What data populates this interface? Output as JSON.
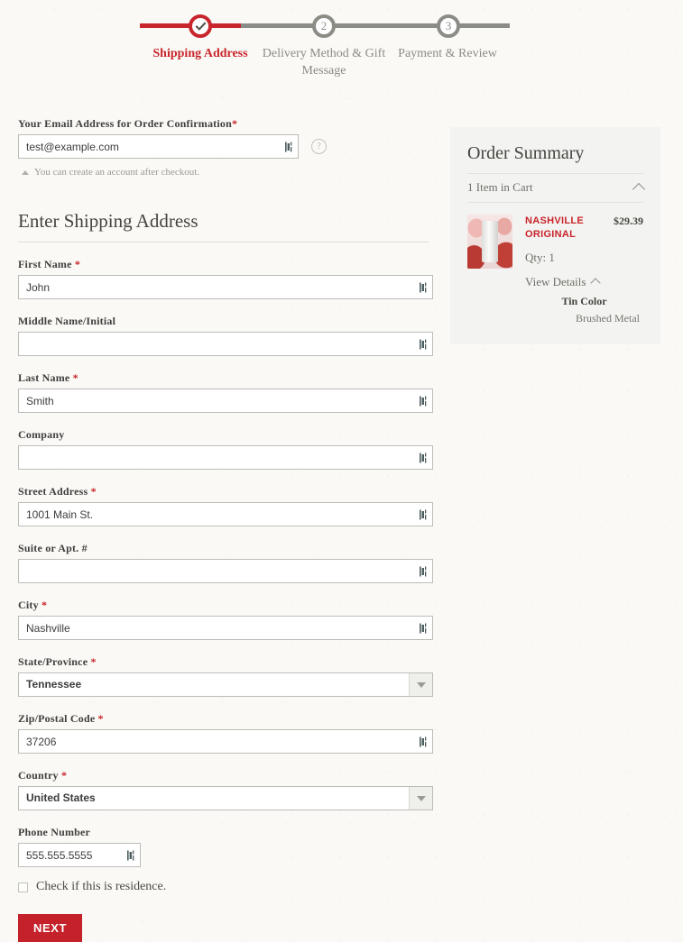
{
  "progress": {
    "steps": [
      {
        "number": "1",
        "label": "Shipping Address",
        "state": "complete",
        "icon": "check-icon"
      },
      {
        "number": "2",
        "label": "Delivery Method & Gift Message",
        "state": "upcoming"
      },
      {
        "number": "3",
        "label": "Payment & Review",
        "state": "upcoming"
      }
    ],
    "accent_color": "#c8252c",
    "inactive_color": "#8c8c86"
  },
  "email_section": {
    "label": "Your Email Address for Order Confirmation",
    "required_marker": "*",
    "value": "test@example.com",
    "placeholder": "",
    "help_icon": "?",
    "note": "You can create an account after checkout."
  },
  "shipping": {
    "heading": "Enter Shipping Address",
    "fields": [
      {
        "label": "First Name",
        "required": true,
        "value": "John",
        "type": "text"
      },
      {
        "label": "Middle Name/Initial",
        "required": false,
        "value": "",
        "type": "text"
      },
      {
        "label": "Last Name",
        "required": true,
        "value": "Smith",
        "type": "text"
      },
      {
        "label": "Company",
        "required": false,
        "value": "",
        "type": "text"
      },
      {
        "label": "Street Address",
        "required": true,
        "value": "1001 Main St.",
        "type": "text"
      },
      {
        "label": "Suite or Apt. #",
        "required": false,
        "value": "",
        "type": "text"
      },
      {
        "label": "City",
        "required": true,
        "value": "Nashville",
        "type": "text"
      },
      {
        "label": "State/Province",
        "required": true,
        "value": "Tennessee",
        "type": "select"
      },
      {
        "label": "Zip/Postal Code",
        "required": true,
        "value": "37206",
        "type": "text"
      },
      {
        "label": "Country",
        "required": true,
        "value": "United States",
        "type": "select"
      },
      {
        "label": "Phone Number",
        "required": false,
        "value": "555.555.5555",
        "type": "text"
      }
    ],
    "residence_checkbox_label": "Check if this is residence.",
    "residence_checked": false,
    "next_button": "NEXT"
  },
  "order_summary": {
    "title": "Order Summary",
    "cart_count_label": "1 Item in Cart",
    "item": {
      "name": "NASHVILLE ORIGINAL",
      "price": "$29.39",
      "qty_label": "Qty: 1",
      "view_details_label": "View Details",
      "option_name": "Tin Color",
      "option_value": "Brushed Metal"
    },
    "panel_color": "#f3f3f1",
    "accent_color": "#c8252c"
  }
}
